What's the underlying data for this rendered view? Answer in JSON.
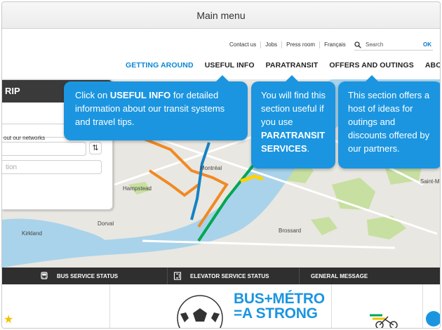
{
  "window": {
    "title": "Main menu"
  },
  "utility_links": [
    "Contact us",
    "Jobs",
    "Press room",
    "Français"
  ],
  "search": {
    "placeholder": "Search",
    "ok_label": "OK"
  },
  "main_nav": [
    {
      "label": "GETTING AROUND",
      "active": true
    },
    {
      "label": "USEFUL INFO",
      "active": false
    },
    {
      "label": "PARATRANSIT",
      "active": false
    },
    {
      "label": "OFFERS AND OUTINGS",
      "active": false
    },
    {
      "label": "ABOUT",
      "active": false
    }
  ],
  "planner": {
    "title_fragment": "RIP",
    "field_placeholder_fragment": "tion",
    "swap_icon": "swap-arrows-icon",
    "networks_link": "out our networks"
  },
  "map_labels": {
    "montreal": "Montréal",
    "hampstead": "Hampstead",
    "kirkland": "Kirkland",
    "dorval": "Dorval",
    "brossard": "Brossard",
    "saint_michel": "Saint-M"
  },
  "status_bar": [
    {
      "label": "BUS SERVICE STATUS",
      "icon": "bus-icon"
    },
    {
      "label": "ELEVATOR SERVICE STATUS",
      "icon": "elevator-icon"
    },
    {
      "label": "GENERAL MESSAGE",
      "icon": ""
    }
  ],
  "tooltips": {
    "useful_info": {
      "pre": "Click on ",
      "bold": "USEFUL INFO",
      "post": " for detailed information about our transit systems and travel tips."
    },
    "paratransit": {
      "pre": "You will find this section useful if you use ",
      "bold": "PARATRANSIT SERVICES",
      "post": "."
    },
    "offers": {
      "text": "This section offers a host of ideas for outings and discounts offered by our partners."
    }
  },
  "promo": {
    "line1": "BUS+MÉTRO",
    "line2": "=A STRONG"
  },
  "colors": {
    "accent": "#1b95e0",
    "nav_active": "#0a87d3",
    "metro_orange": "#f08a24",
    "metro_green": "#00a651",
    "metro_blue": "#1582c5",
    "metro_yellow": "#ffd200",
    "dark_bar": "#2f2f2f"
  }
}
